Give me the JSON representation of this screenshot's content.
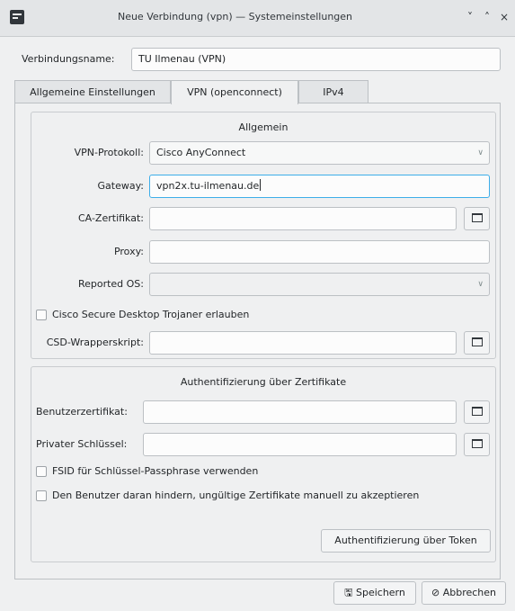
{
  "window": {
    "title": "Neue Verbindung (vpn) — Systemeinstellungen",
    "minimize_icon": "˅",
    "maximize_icon": "˄",
    "close_icon": "×"
  },
  "connection": {
    "name_label": "Verbindungsname:",
    "name_value": "TU Ilmenau (VPN)"
  },
  "tabs": [
    {
      "label": "Allgemeine Einstellungen",
      "active": false
    },
    {
      "label": "VPN (openconnect)",
      "active": true
    },
    {
      "label": "IPv4",
      "active": false
    }
  ],
  "general": {
    "title": "Allgemein",
    "protocol_label": "VPN-Protokoll:",
    "protocol_value": "Cisco AnyConnect",
    "gateway_label": "Gateway:",
    "gateway_value": "vpn2x.tu-ilmenau.de",
    "ca_label": "CA-Zertifikat:",
    "ca_value": "",
    "proxy_label": "Proxy:",
    "proxy_value": "",
    "os_label": "Reported OS:",
    "os_value": "",
    "trojan_label": "Cisco Secure Desktop Trojaner erlauben",
    "csd_label": "CSD-Wrapperskript:",
    "csd_value": ""
  },
  "auth": {
    "title": "Authentifizierung über Zertifikate",
    "usercert_label": "Benutzerzertifikat:",
    "usercert_value": "",
    "privkey_label": "Privater Schlüssel:",
    "privkey_value": "",
    "fsid_label": "FSID für Schlüssel-Passphrase verwenden",
    "prevent_label": "Den Benutzer daran hindern, ungültige Zertifikate manuell zu akzeptieren",
    "token_button": "Authentifizierung über Token"
  },
  "footer": {
    "save_label": "Speichern",
    "cancel_label": "Abbrechen"
  }
}
